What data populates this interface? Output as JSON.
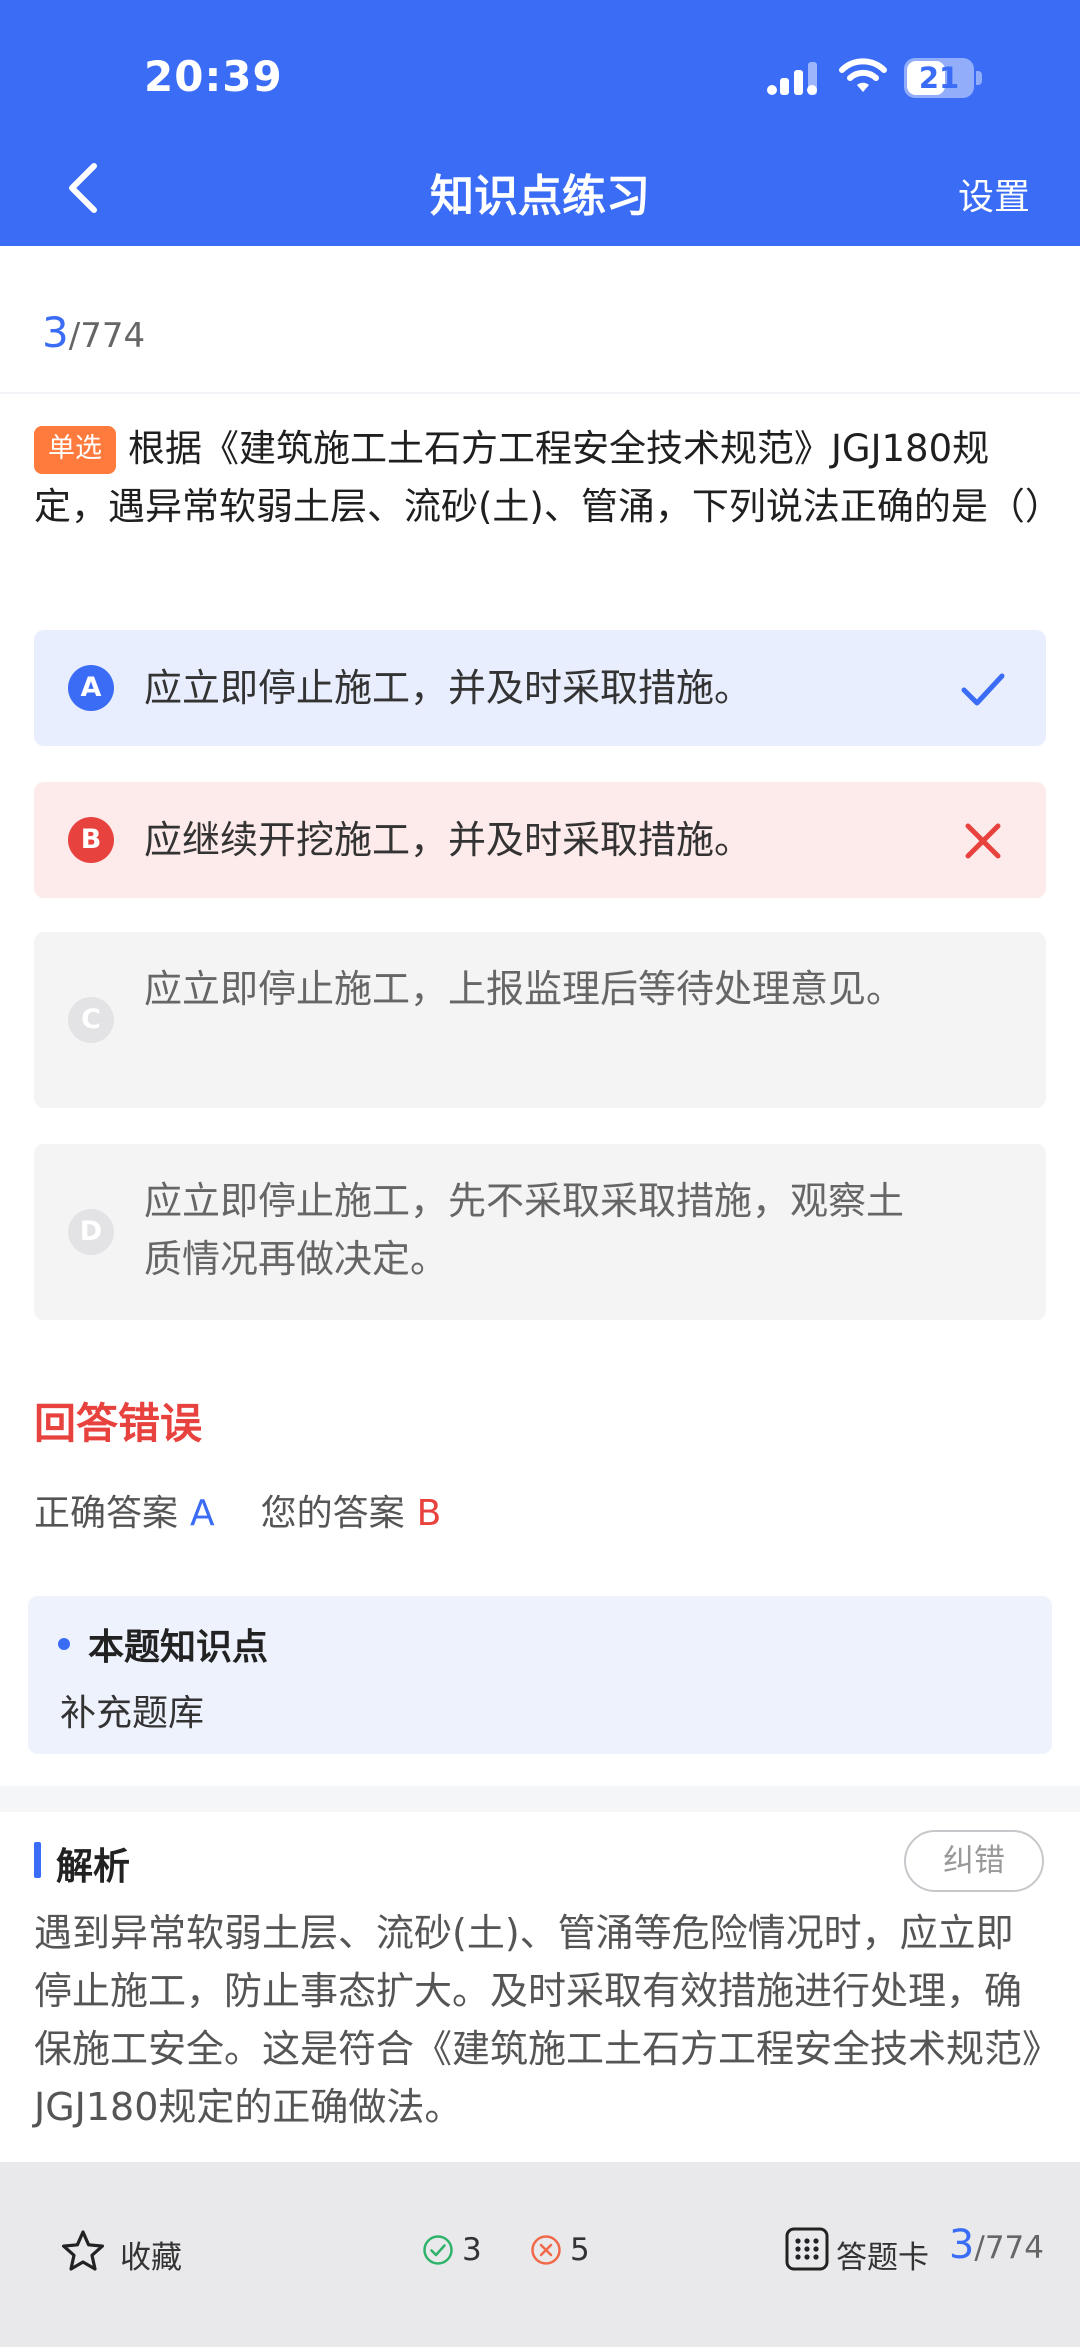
{
  "status_bar": {
    "time": "20:39",
    "battery": "21"
  },
  "header": {
    "title": "知识点练习",
    "settings_label": "设置"
  },
  "progress": {
    "current": "3",
    "total": "/774"
  },
  "question": {
    "type_tag": "单选",
    "text": "根据《建筑施工土石方工程安全技术规范》JGJ180规定，遇异常软弱土层、流砂(土)、管涌，下列说法正确的是（）"
  },
  "options": [
    {
      "letter": "A",
      "text": "应立即停止施工，并及时采取措施。",
      "state": "correct"
    },
    {
      "letter": "B",
      "text": "应继续开挖施工，并及时采取措施。",
      "state": "wrong"
    },
    {
      "letter": "C",
      "text": "应立即停止施工，上报监理后等待处理意见。",
      "state": "normal"
    },
    {
      "letter": "D",
      "text": "应立即停止施工，先不采取采取措施，观察土质情况再做决定。",
      "state": "normal"
    }
  ],
  "result": {
    "title": "回答错误",
    "correct_label": "正确答案",
    "correct_answer": "A",
    "your_label": "您的答案",
    "your_answer": "B"
  },
  "knowledge_point": {
    "title": "本题知识点",
    "value": "补充题库"
  },
  "analysis": {
    "title": "解析",
    "report_label": "纠错",
    "text": "遇到异常软弱土层、流砂(土)、管涌等危险情况时，应立即停止施工，防止事态扩大。及时采取有效措施进行处理，确保施工安全。这是符合《建筑施工土石方工程安全技术规范》JGJ180规定的正确做法。"
  },
  "bottom_bar": {
    "favorite_label": "收藏",
    "correct_count": "3",
    "wrong_count": "5",
    "answer_card_label": "答题卡",
    "current": "3",
    "total": "/774"
  },
  "colors": {
    "primary": "#3a6cf6",
    "error": "#e8423f",
    "tag": "#ff7a3d"
  }
}
